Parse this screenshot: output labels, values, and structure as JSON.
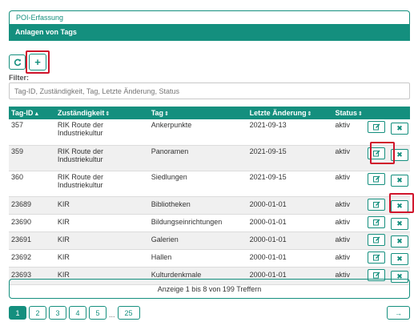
{
  "tabs": {
    "parent": "POI-Erfassung",
    "active": "Anlagen von Tags"
  },
  "toolbar": {
    "refresh_icon": "refresh-icon",
    "add_label": "+"
  },
  "filter": {
    "label": "Filter:",
    "placeholder": "Tag-ID, Zuständigkeit, Tag, Letzte Änderung, Status",
    "value": ""
  },
  "table": {
    "headers": [
      "Tag-ID",
      "Zuständigkeit",
      "Tag",
      "Letzte Änderung",
      "Status"
    ],
    "rows": [
      {
        "id": "357",
        "zust": "RIK Route der Industriekultur",
        "tag": "Ankerpunkte",
        "date": "2021-09-13",
        "status": "aktiv"
      },
      {
        "id": "359",
        "zust": "RIK Route der Industriekultur",
        "tag": "Panoramen",
        "date": "2021-09-15",
        "status": "aktiv"
      },
      {
        "id": "360",
        "zust": "RIK Route der Industriekultur",
        "tag": "Siedlungen",
        "date": "2021-09-15",
        "status": "aktiv"
      },
      {
        "id": "23689",
        "zust": "KIR",
        "tag": "Bibliotheken",
        "date": "2000-01-01",
        "status": "aktiv"
      },
      {
        "id": "23690",
        "zust": "KIR",
        "tag": "Bildungseinrichtungen",
        "date": "2000-01-01",
        "status": "aktiv"
      },
      {
        "id": "23691",
        "zust": "KIR",
        "tag": "Galerien",
        "date": "2000-01-01",
        "status": "aktiv"
      },
      {
        "id": "23692",
        "zust": "KIR",
        "tag": "Hallen",
        "date": "2000-01-01",
        "status": "aktiv"
      },
      {
        "id": "23693",
        "zust": "KIR",
        "tag": "Kulturdenkmale",
        "date": "2000-01-01",
        "status": "aktiv"
      }
    ]
  },
  "info": "Anzeige 1 bis 8 von 199 Treffern",
  "pagination": {
    "pages": [
      "1",
      "2",
      "3",
      "4",
      "5"
    ],
    "ellipsis": "...",
    "last": "25",
    "next_label": "→"
  },
  "colors": {
    "accent": "#148f7e",
    "highlight": "#d0142b"
  }
}
